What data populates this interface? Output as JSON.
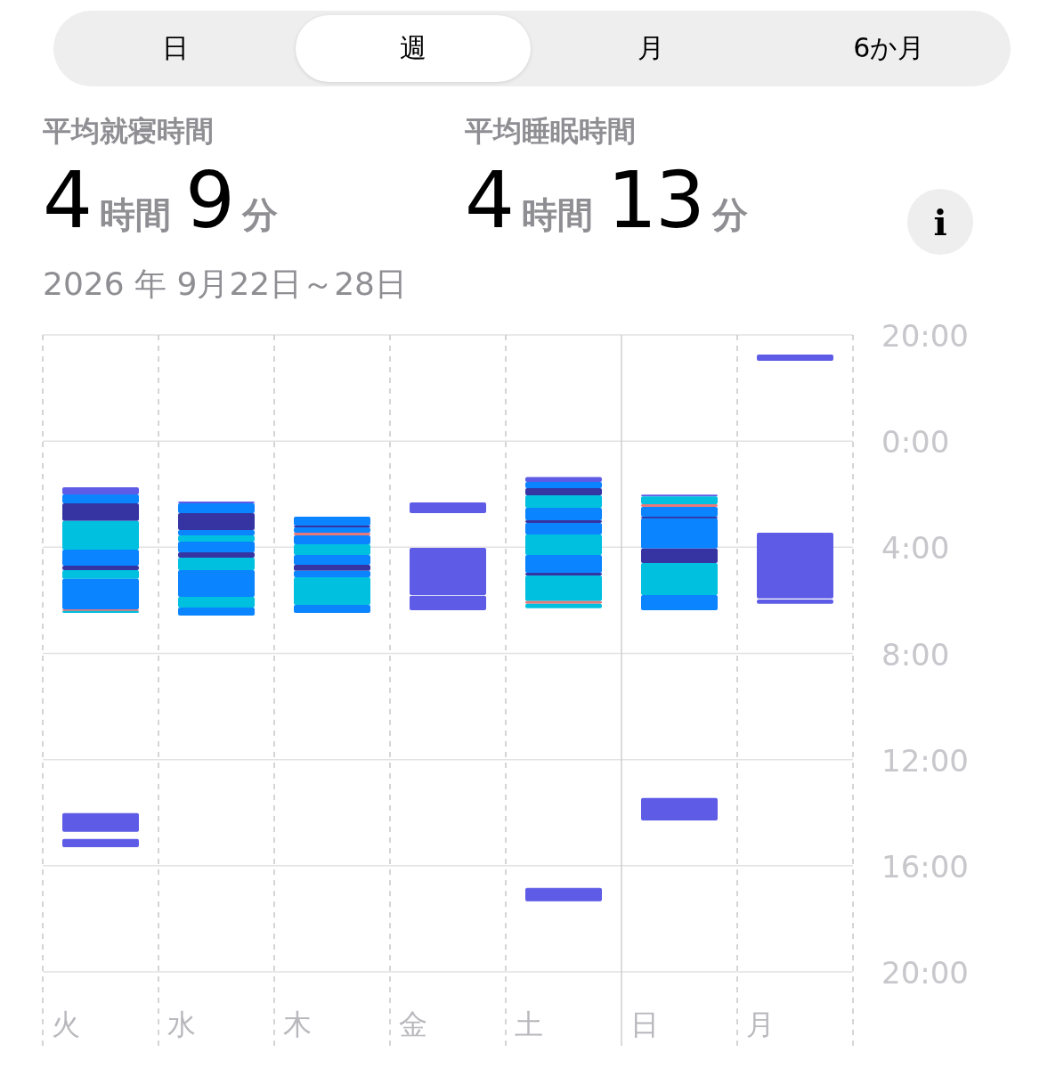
{
  "segments": [
    {
      "label": "日",
      "selected": false
    },
    {
      "label": "週",
      "selected": true
    },
    {
      "label": "月",
      "selected": false
    },
    {
      "label": "6か月",
      "selected": false
    }
  ],
  "stats": [
    {
      "label": "平均就寝時間",
      "hours": "4",
      "hours_unit": "時間",
      "minutes": "9",
      "minutes_unit": "分"
    },
    {
      "label": "平均睡眠時間",
      "hours": "4",
      "hours_unit": "時間",
      "minutes": "13",
      "minutes_unit": "分"
    }
  ],
  "info_button": "i",
  "date_range": "2026 年 9月22日～28日",
  "chart": {
    "time_labels": [
      "20:00",
      "0:00",
      "4:00",
      "8:00",
      "12:00",
      "16:00",
      "20:00"
    ],
    "day_labels": [
      "火",
      "水",
      "木",
      "金",
      "土",
      "日",
      "月"
    ]
  }
}
